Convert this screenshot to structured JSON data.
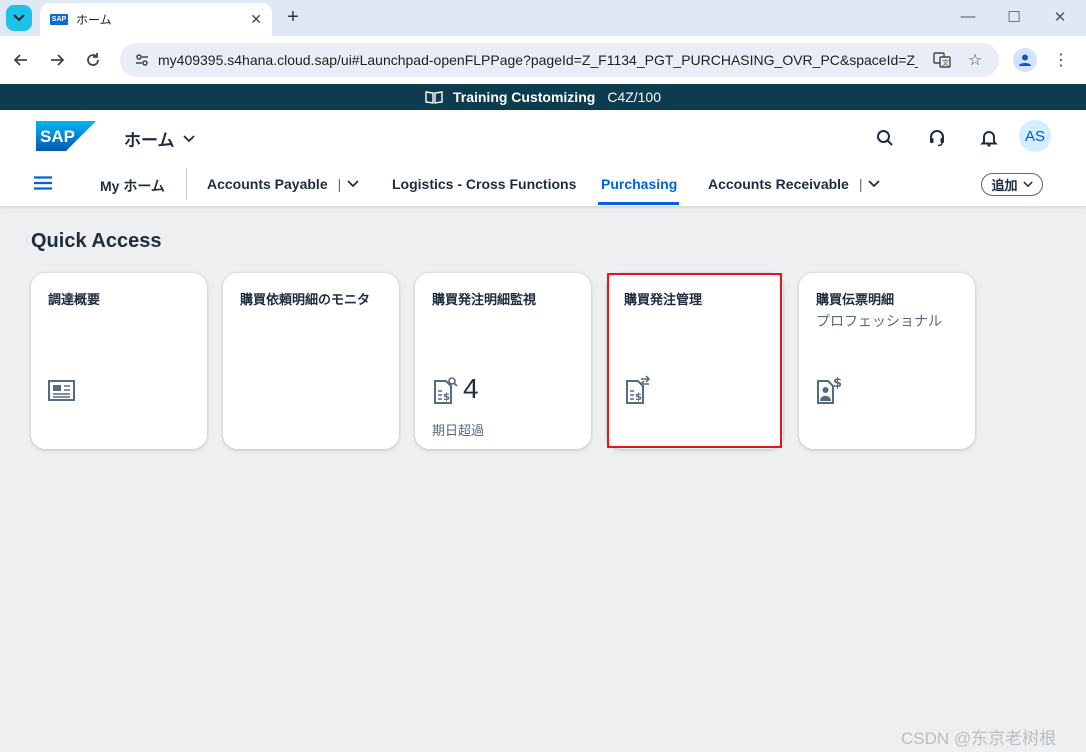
{
  "browser": {
    "tab_title": "ホーム",
    "url": "my409395.s4hana.cloud.sap/ui#Launchpad-openFLPPage?pageId=Z_F1134_PGT_PURCHASING_OVR_PC&spaceId=Z_F113..."
  },
  "system_banner": {
    "title": "Training Customizing",
    "system_id": "C4Z/100"
  },
  "shell": {
    "logo": "SAP",
    "home_title": "ホーム",
    "avatar_initials": "AS",
    "icons": [
      "search-icon",
      "headset-icon",
      "bell-icon"
    ]
  },
  "nav": {
    "my_home": "My ホーム",
    "spaces": [
      {
        "label": "Accounts Payable",
        "has_menu": true
      },
      {
        "label": "Logistics - Cross Functions",
        "has_menu": false
      },
      {
        "label": "Purchasing",
        "active": true
      },
      {
        "label": "Accounts Receivable",
        "has_menu": true
      }
    ],
    "add_button": "追加"
  },
  "main": {
    "section_title": "Quick Access",
    "tiles": [
      {
        "title": "調達概要",
        "subtitle": "",
        "icon": "overview-report-icon"
      },
      {
        "title": "購買依頼明細のモニタ",
        "subtitle": "",
        "icon": ""
      },
      {
        "title": "購買発注明細監視",
        "subtitle": "",
        "icon": "monitor-document-icon",
        "number": "4",
        "footer": "期日超過"
      },
      {
        "title": "購買発注管理",
        "subtitle": "",
        "icon": "manage-document-icon",
        "highlighted": true
      },
      {
        "title": "購買伝票明細",
        "subtitle": "プロフェッショナル",
        "icon": "user-dollar-icon"
      }
    ]
  },
  "watermark": "CSDN @东京老树根",
  "colors": {
    "sap_blue": "#0064d9",
    "banner": "#0c3c4e",
    "highlight": "#e8141a"
  }
}
